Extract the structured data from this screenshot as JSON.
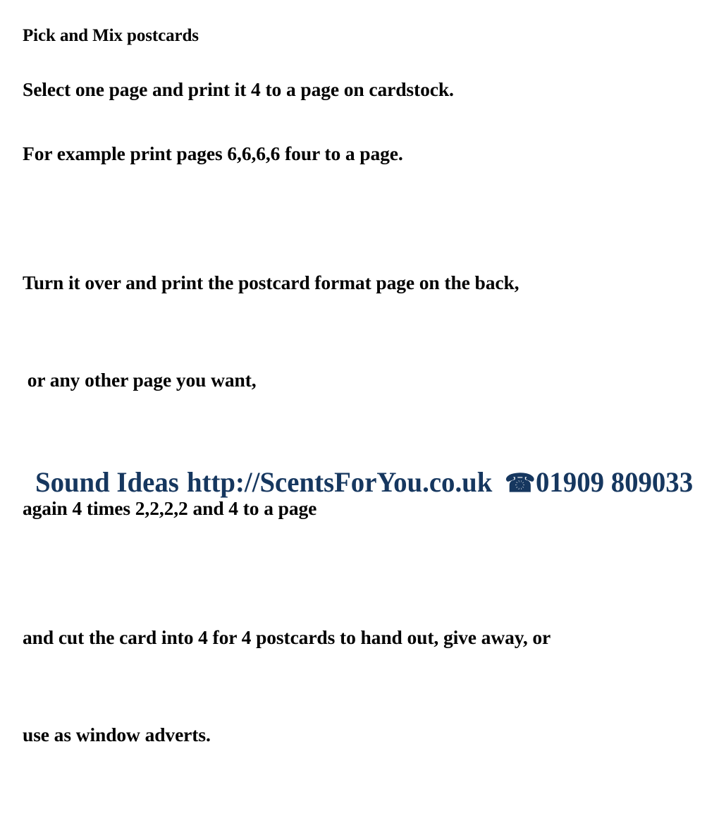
{
  "document": {
    "heading": "Pick and Mix postcards",
    "paragraphs": [
      {
        "lines": [
          "Select one page and print it 4 to a page on cardstock."
        ]
      },
      {
        "lines": [
          "For example print pages 6,6,6,6 four to a page."
        ]
      },
      {
        "lines": [
          "Turn it over and print the postcard format page on the back,",
          " or any other page you want,"
        ]
      },
      {
        "lines": [
          "again 4 times 2,2,2,2 and 4 to a page"
        ]
      },
      {
        "lines": [
          "and cut the card into 4 for 4 postcards to hand out, give away, or",
          "use as window adverts."
        ]
      }
    ]
  },
  "footer": {
    "brand": "Sound Ideas",
    "website": "http://ScentsForYou.co.uk",
    "phone_icon": "☎",
    "phone": "01909 809033",
    "color": "#16375f",
    "shadow_color": "#3b6ea5"
  },
  "page": {
    "background": "#ffffff",
    "text_color": "#000000"
  }
}
